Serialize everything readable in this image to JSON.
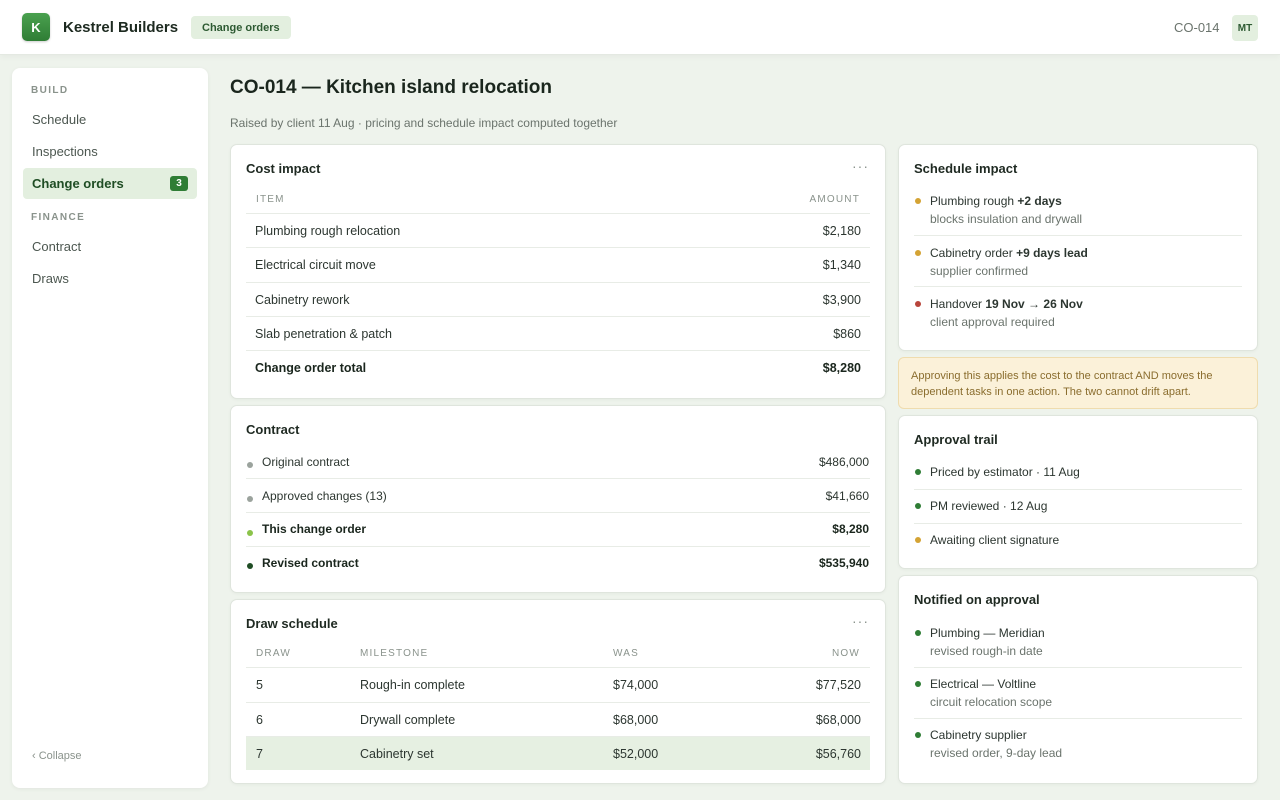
{
  "header": {
    "logo_letter": "K",
    "brand": "Kestrel Builders",
    "section": "Change orders",
    "co_id": "CO-014",
    "avatar": "MT"
  },
  "sidebar": {
    "sections": [
      {
        "label": "BUILD"
      },
      {
        "label": "FINANCE"
      }
    ],
    "items": [
      {
        "label": "Schedule"
      },
      {
        "label": "Inspections"
      },
      {
        "label": "Change orders",
        "badge": "3"
      },
      {
        "label": "Contract"
      },
      {
        "label": "Draws"
      }
    ],
    "collapse": "‹ Collapse"
  },
  "page": {
    "title": "CO-014 — Kitchen island relocation",
    "subtitle": "Raised by client 11 Aug · pricing and schedule impact computed together"
  },
  "cost_impact": {
    "title": "Cost impact",
    "col_item": "ITEM",
    "col_amount": "AMOUNT",
    "rows": [
      {
        "item": "Plumbing rough relocation",
        "amount": "$2,180"
      },
      {
        "item": "Electrical circuit move",
        "amount": "$1,340"
      },
      {
        "item": "Cabinetry rework",
        "amount": "$3,900"
      },
      {
        "item": "Slab penetration & patch",
        "amount": "$860"
      }
    ],
    "total_label": "Change order total",
    "total_amount": "$8,280"
  },
  "contract": {
    "title": "Contract",
    "rows": [
      {
        "label": "Original contract",
        "value": "$486,000"
      },
      {
        "label": "Approved changes (13)",
        "value": "$41,660"
      },
      {
        "label": "This change order",
        "value": "$8,280"
      },
      {
        "label": "Revised contract",
        "value": "$535,940"
      }
    ]
  },
  "draw_schedule": {
    "title": "Draw schedule",
    "col_draw": "DRAW",
    "col_milestone": "MILESTONE",
    "col_was": "WAS",
    "col_now": "NOW",
    "rows": [
      {
        "draw": "5",
        "milestone": "Rough-in complete",
        "was": "$74,000",
        "now": "$77,520"
      },
      {
        "draw": "6",
        "milestone": "Drywall complete",
        "was": "$68,000",
        "now": "$68,000"
      },
      {
        "draw": "7",
        "milestone": "Cabinetry set",
        "was": "$52,000",
        "now": "$56,760"
      }
    ]
  },
  "schedule_impact": {
    "title": "Schedule impact",
    "items": [
      {
        "label": "Plumbing rough",
        "strong": "+2 days",
        "detail": "blocks insulation and drywall",
        "color": "#d4a334"
      },
      {
        "label": "Cabinetry order",
        "strong": "+9 days lead",
        "detail": "supplier confirmed",
        "color": "#d4a334"
      },
      {
        "label": "Handover",
        "strong": "19 Nov → 26 Nov",
        "detail": "client approval required",
        "color": "#b8453b"
      }
    ]
  },
  "note": "Approving this applies the cost to the contract AND moves the dependent tasks in one action. The two cannot drift apart.",
  "approval_trail": {
    "title": "Approval trail",
    "items": [
      {
        "label": "Priced by estimator · 11 Aug",
        "color": "#2f7d35"
      },
      {
        "label": "PM reviewed · 12 Aug",
        "color": "#2f7d35"
      },
      {
        "label": "Awaiting client signature",
        "color": "#d4a334"
      }
    ]
  },
  "notified": {
    "title": "Notified on approval",
    "items": [
      {
        "label": "Plumbing — Meridian",
        "detail": "revised rough-in date"
      },
      {
        "label": "Electrical — Voltline",
        "detail": "circuit relocation scope"
      },
      {
        "label": "Cabinetry supplier",
        "detail": "revised order, 9-day lead"
      }
    ]
  },
  "colors": {
    "accent": "#2f7d35",
    "accent_soft": "#e3efdf",
    "warning": "#d4a334",
    "danger": "#b8453b"
  }
}
